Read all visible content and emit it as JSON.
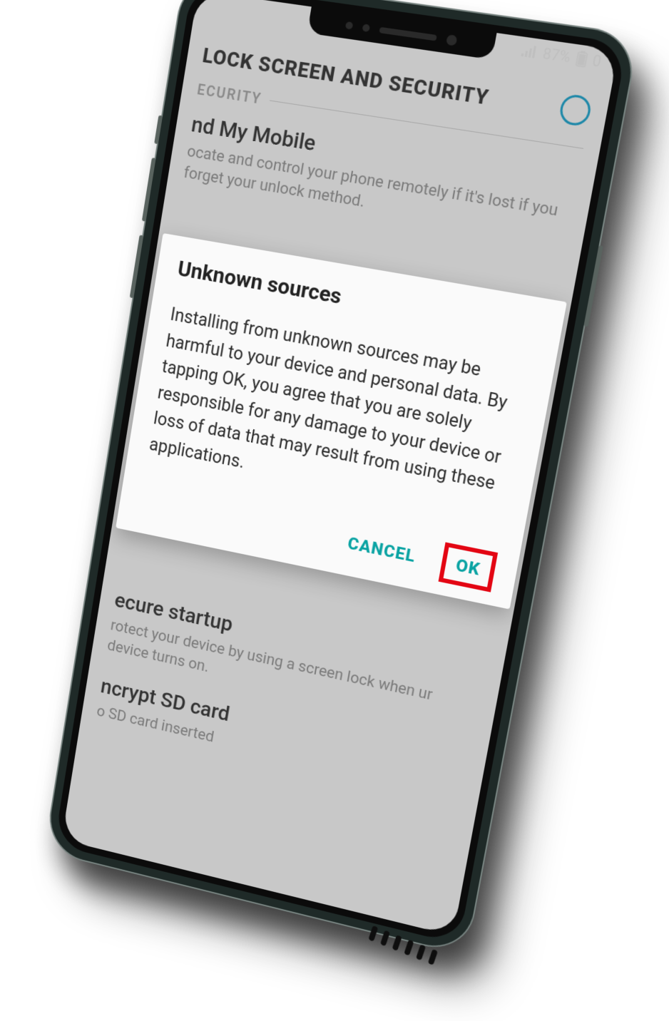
{
  "statusbar": {
    "battery_pct": "87%",
    "time_fragment": "0"
  },
  "header": {
    "title": "LOCK SCREEN AND SECURITY"
  },
  "section_label": "ECURITY",
  "settings": {
    "find_my_mobile": {
      "title": "nd My Mobile",
      "desc": "ocate and control your phone remotely if it's lost if you forget your unlock method."
    },
    "secure_startup": {
      "title": "ecure startup",
      "desc": "rotect your device by using a screen lock when ur device turns on."
    },
    "encrypt_sd": {
      "title": "ncrypt SD card",
      "desc": "o SD card inserted"
    }
  },
  "dialog": {
    "title": "Unknown sources",
    "body": "Installing from unknown sources may be harmful to your device and personal data. By tapping OK, you agree that you are solely responsible for any damage to your device or loss of data that may result from using these applications.",
    "cancel": "CANCEL",
    "ok": "OK"
  }
}
